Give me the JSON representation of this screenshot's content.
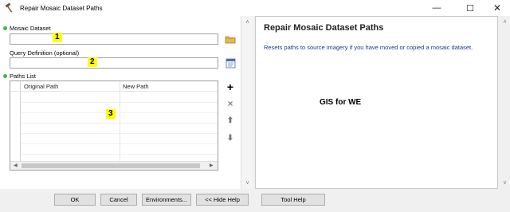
{
  "window": {
    "title": "Repair Mosaic Dataset Paths",
    "icon": "hammer-icon",
    "controls": {
      "minimize": "—",
      "maximize": "☐",
      "close": "✕"
    }
  },
  "form": {
    "mosaic_dataset": {
      "label": "Mosaic Dataset",
      "value": "",
      "marker": "1",
      "required": true
    },
    "query_definition": {
      "label": "Query Definition (optional)",
      "value": "",
      "marker": "2"
    },
    "paths_list": {
      "label": "Paths List",
      "marker": "3",
      "columns": [
        "Original Path",
        "New Path"
      ],
      "rows": []
    },
    "side_buttons": {
      "add": "+",
      "remove": "×",
      "up": "⬆",
      "down": "⬇"
    }
  },
  "help_panel": {
    "title": "Repair Mosaic Dataset Paths",
    "body": "Resets paths to source imagery if you have moved or copied a mosaic dataset.",
    "overlay": "GIS for WE"
  },
  "buttons": {
    "ok": "OK",
    "cancel": "Cancel",
    "environments": "Environments...",
    "hide_help": "<< Hide Help",
    "tool_help": "Tool Help"
  },
  "colors": {
    "required_dot": "#3cb44b",
    "marker_highlight": "#ffff00",
    "help_body_text": "#1f3a8a"
  }
}
